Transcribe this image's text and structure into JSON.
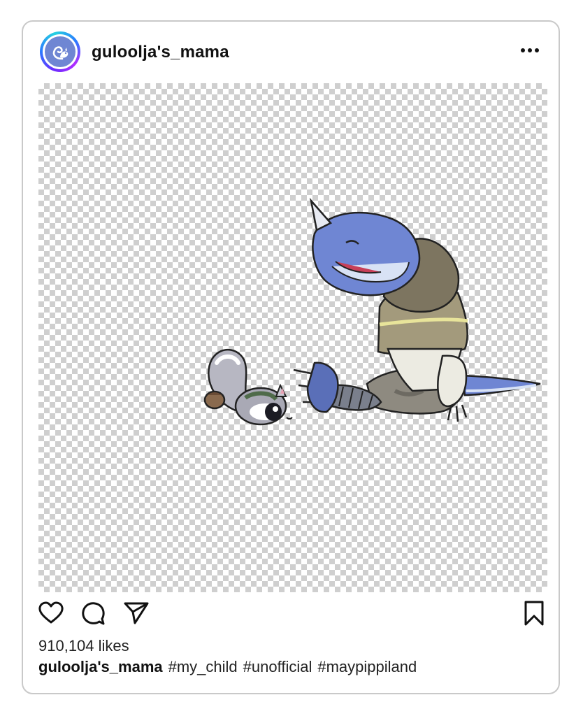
{
  "post": {
    "username": "guloolja's_mama",
    "likes_text": "910,104 likes",
    "caption_user": "guloolja's_mama",
    "hashtags": [
      "#my_child",
      "#unofficial",
      "#maypippiland"
    ]
  },
  "icons": {
    "avatar": "squirrel-icon",
    "more": "more-options-icon",
    "like": "heart-icon",
    "comment": "comment-icon",
    "share": "send-icon",
    "save": "bookmark-icon"
  },
  "colors": {
    "card_border": "#c9c9c9",
    "avatar_ring_start": "#6a2cff",
    "avatar_ring_end": "#26d3e0",
    "avatar_fill": "#6f86d3",
    "text": "#111111"
  }
}
